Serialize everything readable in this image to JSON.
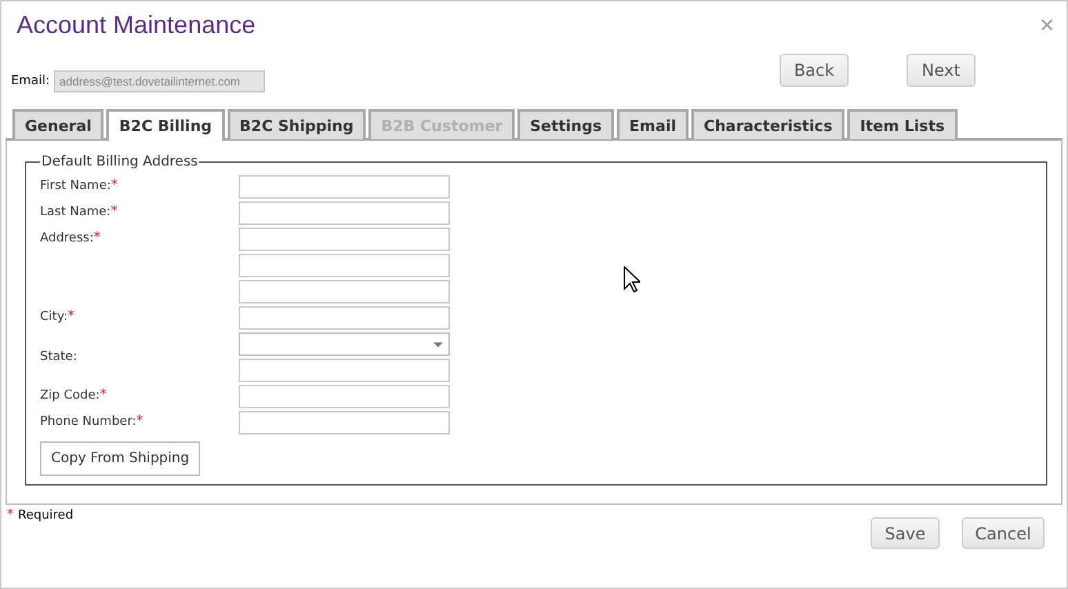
{
  "window": {
    "title": "Account Maintenance",
    "close": "×"
  },
  "email": {
    "label": "Email:",
    "value": "address@test.dovetailinternet.com",
    "disabled": true
  },
  "nav_buttons": [
    "Back",
    "Next"
  ],
  "tabs": [
    {
      "label": "General",
      "selected": false,
      "disabled": false
    },
    {
      "label": "B2C Billing",
      "selected": true,
      "disabled": false
    },
    {
      "label": "B2C Shipping",
      "selected": false,
      "disabled": false
    },
    {
      "label": "B2B Customer",
      "selected": false,
      "disabled": true
    },
    {
      "label": "Settings",
      "selected": false,
      "disabled": false
    },
    {
      "label": "Email",
      "selected": false,
      "disabled": false
    },
    {
      "label": "Characteristics",
      "selected": false,
      "disabled": false
    },
    {
      "label": "Item Lists",
      "selected": false,
      "disabled": false
    }
  ],
  "group": {
    "legend": "Default Billing Address",
    "rows": [
      {
        "label": "First Name:",
        "mark": "*",
        "inputs": [
          {
            "kind": "text"
          }
        ]
      },
      {
        "label": "Last Name:",
        "mark": "*",
        "inputs": [
          {
            "kind": "text"
          }
        ]
      },
      {
        "label": "Address:",
        "mark": "*",
        "inputs": [
          {
            "kind": "text"
          },
          {
            "kind": "text"
          },
          {
            "kind": "text"
          }
        ]
      },
      {
        "label": "City:",
        "mark": "*",
        "inputs": [
          {
            "kind": "text"
          }
        ]
      },
      {
        "label": "State:",
        "inputs": [
          {
            "kind": "select"
          },
          {
            "kind": "text"
          }
        ]
      },
      {
        "label": "Zip Code:",
        "mark": "*",
        "inputs": [
          {
            "kind": "text"
          }
        ]
      },
      {
        "label": "Phone Number:",
        "mark": "*",
        "inputs": [
          {
            "kind": "text"
          }
        ]
      }
    ],
    "button": "Copy From Shipping"
  },
  "footnote": {
    "mark": "*",
    "text": "Required"
  },
  "buttons": [
    "Save",
    "Cancel"
  ]
}
